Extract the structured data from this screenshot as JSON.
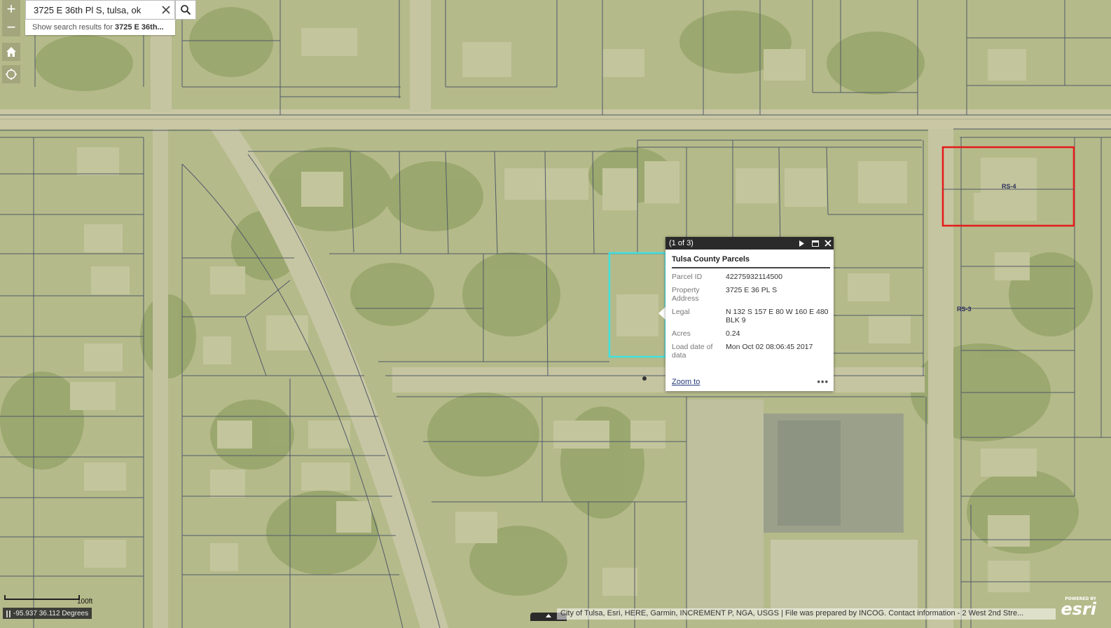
{
  "search": {
    "value": "3725 E 36th Pl S, tulsa, ok",
    "suggestion_prefix": "Show search results for ",
    "suggestion_bold": "3725 E 36th..."
  },
  "controls": {
    "zoom_in": "+",
    "zoom_out": "−"
  },
  "zoning_labels": [
    "RS-4",
    "RS-3"
  ],
  "popup": {
    "counter": "(1 of 3)",
    "layer_title": "Tulsa County Parcels",
    "fields": [
      {
        "label": "Parcel ID",
        "value": "42275932114500"
      },
      {
        "label": "Property Address",
        "value": "3725 E 36 PL S"
      },
      {
        "label": "Legal",
        "value": "N 132 S 157 E 80 W 160 E 480 BLK 9"
      },
      {
        "label": "Acres",
        "value": "0.24"
      },
      {
        "label": "Load date of data",
        "value": "Mon Oct 02 08:06:45 2017"
      }
    ],
    "zoom_to": "Zoom to",
    "more": "•••"
  },
  "scale": {
    "label": "100ft"
  },
  "coordinates": "-95.937 36.112 Degrees",
  "attribution": "City of Tulsa, Esri, HERE, Garmin, INCREMENT P, NGA, USGS | File was prepared by INCOG. Contact information - 2 West 2nd Stre...",
  "logo": {
    "powered": "POWERED BY",
    "word": "esri"
  },
  "colors": {
    "selected_parcel": "#3fe0e0",
    "highlighted_parcels": "#e41b1b",
    "parcel_lines": "#505a68",
    "popup_header": "#2a2a2a",
    "link": "#223b7a"
  }
}
